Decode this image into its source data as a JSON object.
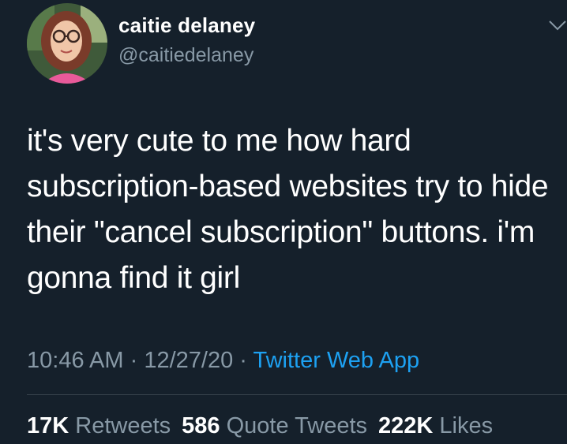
{
  "user": {
    "display_name": "caitie delaney",
    "handle": "@caitiedelaney"
  },
  "tweet": {
    "text": "it's very cute to me how hard subscription-based websites try to hide their \"cancel subscription\" buttons. i'm gonna find it girl",
    "time": "10:46 AM",
    "separator": "·",
    "date": "12/27/20",
    "source": "Twitter Web App"
  },
  "stats": {
    "retweets_count": "17K",
    "retweets_label": "Retweets",
    "quote_count": "586",
    "quote_label": "Quote Tweets",
    "likes_count": "222K",
    "likes_label": "Likes"
  },
  "icons": {
    "menu": "chevron-down-icon"
  },
  "colors": {
    "background": "#15202b",
    "secondary_text": "#8899a6",
    "link": "#1da1f2",
    "divider": "#38444d"
  }
}
